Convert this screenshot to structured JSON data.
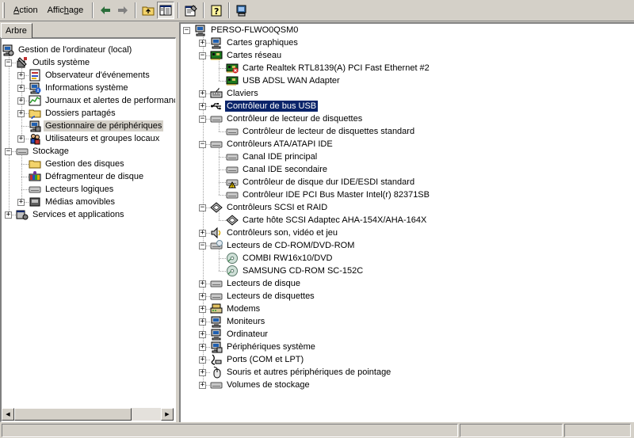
{
  "menu": {
    "action": "Action",
    "action_key": "A",
    "view": "Affichage",
    "view_key": "h"
  },
  "toolbar": {
    "buttons": [
      "back-arrow-icon",
      "forward-arrow-icon",
      "up-folder-icon",
      "show-tree-icon",
      "properties-icon",
      "help-icon",
      "device-scan-icon"
    ]
  },
  "left": {
    "tab_label": "Arbre",
    "tree": [
      {
        "label": "Gestion de l'ordinateur (local)",
        "icon": "computer-mgmt-icon",
        "level": 0,
        "expander": "minus"
      },
      {
        "label": "Outils système",
        "icon": "tools-icon",
        "level": 1,
        "expander": "minus"
      },
      {
        "label": "Observateur d'événements",
        "icon": "event-viewer-icon",
        "level": 2,
        "expander": "plus"
      },
      {
        "label": "Informations système",
        "icon": "sysinfo-icon",
        "level": 2,
        "expander": "plus"
      },
      {
        "label": "Journaux et alertes de performance",
        "icon": "perf-logs-icon",
        "level": 2,
        "expander": "plus"
      },
      {
        "label": "Dossiers partagés",
        "icon": "shared-folder-icon",
        "level": 2,
        "expander": "plus"
      },
      {
        "label": "Gestionnaire de périphériques",
        "icon": "device-manager-icon",
        "level": 2,
        "expander": "none",
        "selected": true
      },
      {
        "label": "Utilisateurs et groupes locaux",
        "icon": "users-groups-icon",
        "level": 2,
        "expander": "plus"
      },
      {
        "label": "Stockage",
        "icon": "storage-icon",
        "level": 1,
        "expander": "minus"
      },
      {
        "label": "Gestion des disques",
        "icon": "disk-management-icon",
        "level": 2,
        "expander": "none"
      },
      {
        "label": "Défragmenteur de disque",
        "icon": "defrag-icon",
        "level": 2,
        "expander": "none"
      },
      {
        "label": "Lecteurs logiques",
        "icon": "logical-drive-icon",
        "level": 2,
        "expander": "none"
      },
      {
        "label": "Médias amovibles",
        "icon": "removable-media-icon",
        "level": 2,
        "expander": "plus"
      },
      {
        "label": "Services et applications",
        "icon": "services-apps-icon",
        "level": 1,
        "expander": "plus"
      }
    ]
  },
  "right": {
    "tree": [
      {
        "label": "PERSO-FLWO0QSM0",
        "icon": "computer-icon",
        "level": 0,
        "expander": "minus"
      },
      {
        "label": "Cartes graphiques",
        "icon": "display-adapter-icon",
        "level": 1,
        "expander": "plus"
      },
      {
        "label": "Cartes réseau",
        "icon": "network-card-icon",
        "level": 1,
        "expander": "minus"
      },
      {
        "label": "Carte Realtek RTL8139(A) PCI Fast Ethernet #2",
        "icon": "network-card-disabled-icon",
        "level": 2,
        "expander": "none"
      },
      {
        "label": "USB ADSL WAN Adapter",
        "icon": "network-card-icon",
        "level": 2,
        "expander": "none"
      },
      {
        "label": "Claviers",
        "icon": "keyboard-icon",
        "level": 1,
        "expander": "plus"
      },
      {
        "label": "Contrôleur de bus USB",
        "icon": "usb-icon",
        "level": 1,
        "expander": "plus",
        "focused": true
      },
      {
        "label": "Contrôleur de lecteur de disquettes",
        "icon": "floppy-controller-icon",
        "level": 1,
        "expander": "minus"
      },
      {
        "label": "Contrôleur de lecteur de disquettes standard",
        "icon": "floppy-controller-icon",
        "level": 2,
        "expander": "none"
      },
      {
        "label": "Contrôleurs ATA/ATAPI IDE",
        "icon": "ide-controller-icon",
        "level": 1,
        "expander": "minus"
      },
      {
        "label": "Canal IDE principal",
        "icon": "ide-controller-icon",
        "level": 2,
        "expander": "none"
      },
      {
        "label": "Canal IDE secondaire",
        "icon": "ide-controller-icon",
        "level": 2,
        "expander": "none"
      },
      {
        "label": "Contrôleur de disque dur IDE/ESDI standard",
        "icon": "ide-warning-icon",
        "level": 2,
        "expander": "none"
      },
      {
        "label": "Contrôleur IDE PCI Bus Master Intel(r) 82371SB",
        "icon": "ide-controller-icon",
        "level": 2,
        "expander": "none"
      },
      {
        "label": "Contrôleurs SCSI et RAID",
        "icon": "scsi-icon",
        "level": 1,
        "expander": "minus"
      },
      {
        "label": "Carte hôte SCSI Adaptec AHA-154X/AHA-164X",
        "icon": "scsi-icon",
        "level": 2,
        "expander": "none"
      },
      {
        "label": "Contrôleurs son, vidéo et jeu",
        "icon": "sound-icon",
        "level": 1,
        "expander": "plus"
      },
      {
        "label": "Lecteurs de CD-ROM/DVD-ROM",
        "icon": "cdrom-drive-icon",
        "level": 1,
        "expander": "minus"
      },
      {
        "label": "COMBI RW16x10/DVD",
        "icon": "cdrom-icon",
        "level": 2,
        "expander": "none"
      },
      {
        "label": "SAMSUNG CD-ROM SC-152C",
        "icon": "cdrom-icon",
        "level": 2,
        "expander": "none"
      },
      {
        "label": "Lecteurs de disque",
        "icon": "disk-drive-icon",
        "level": 1,
        "expander": "plus"
      },
      {
        "label": "Lecteurs de disquettes",
        "icon": "floppy-drive-icon",
        "level": 1,
        "expander": "plus"
      },
      {
        "label": "Modems",
        "icon": "modem-icon",
        "level": 1,
        "expander": "plus"
      },
      {
        "label": "Moniteurs",
        "icon": "monitor-icon",
        "level": 1,
        "expander": "plus"
      },
      {
        "label": "Ordinateur",
        "icon": "computer-icon",
        "level": 1,
        "expander": "plus"
      },
      {
        "label": "Périphériques système",
        "icon": "system-devices-icon",
        "level": 1,
        "expander": "plus"
      },
      {
        "label": "Ports (COM et LPT)",
        "icon": "ports-icon",
        "level": 1,
        "expander": "plus"
      },
      {
        "label": "Souris et autres périphériques de pointage",
        "icon": "mouse-icon",
        "level": 1,
        "expander": "plus"
      },
      {
        "label": "Volumes de stockage",
        "icon": "storage-volume-icon",
        "level": 1,
        "expander": "plus"
      }
    ]
  },
  "colors": {
    "selection": "#0a246a",
    "face": "#d4d0c8"
  }
}
